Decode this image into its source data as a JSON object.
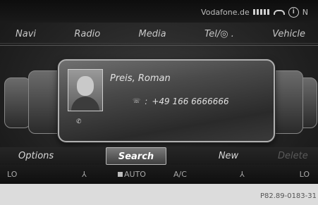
{
  "status": {
    "carrier": "Vodafone.de",
    "network_type": "N"
  },
  "menu": {
    "items": [
      "Navi",
      "Radio",
      "Media",
      "Tel/",
      "Vehicle"
    ],
    "tel_icon_glyph": "◎"
  },
  "contact": {
    "name": "Preis, Roman",
    "phone_number": "+49 166 6666666",
    "phone_separator": ":"
  },
  "submenu": {
    "options": "Options",
    "search": "Search",
    "new": "New",
    "delete": "Delete"
  },
  "climate": {
    "temp_left": "LO",
    "auto": "AUTO",
    "ac_label": "A/C",
    "temp_right": "LO"
  },
  "footer": {
    "code": "P82.89-0183-31"
  },
  "colors": {
    "background": "#1a1a1a",
    "accent_highlight": "#b8b8b8",
    "delete_disabled": "#5a5a5a"
  }
}
